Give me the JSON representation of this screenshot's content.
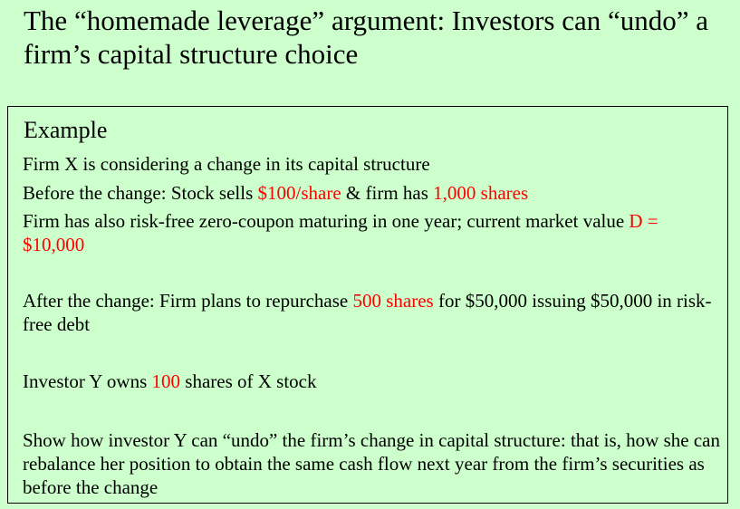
{
  "title": "The “homemade leverage” argument: Investors can “undo” a firm’s capital structure choice",
  "box": {
    "heading": "Example",
    "line1": "Firm X is considering a change in its capital structure",
    "line2": {
      "t1": "Before the change: Stock sells ",
      "r1": "$100/share",
      "t2": " & firm has ",
      "r2": "1,000 shares"
    },
    "line3": {
      "t1": "Firm has also risk-free zero-coupon maturing in one year; current market value ",
      "r1": "D = $10,000"
    },
    "line4": {
      "t1": "After the change: Firm plans to repurchase ",
      "r1": "500 shares",
      "t2": " for $50,000 issuing $50,000 in risk-free debt"
    },
    "line5": {
      "t1": "Investor Y owns ",
      "r1": "100",
      "t2": " shares of X stock"
    },
    "line6": "Show how investor Y can “undo” the firm’s change in capital structure: that is, how she can rebalance her position to obtain the same cash flow next year from the firm’s securities as before the change"
  }
}
